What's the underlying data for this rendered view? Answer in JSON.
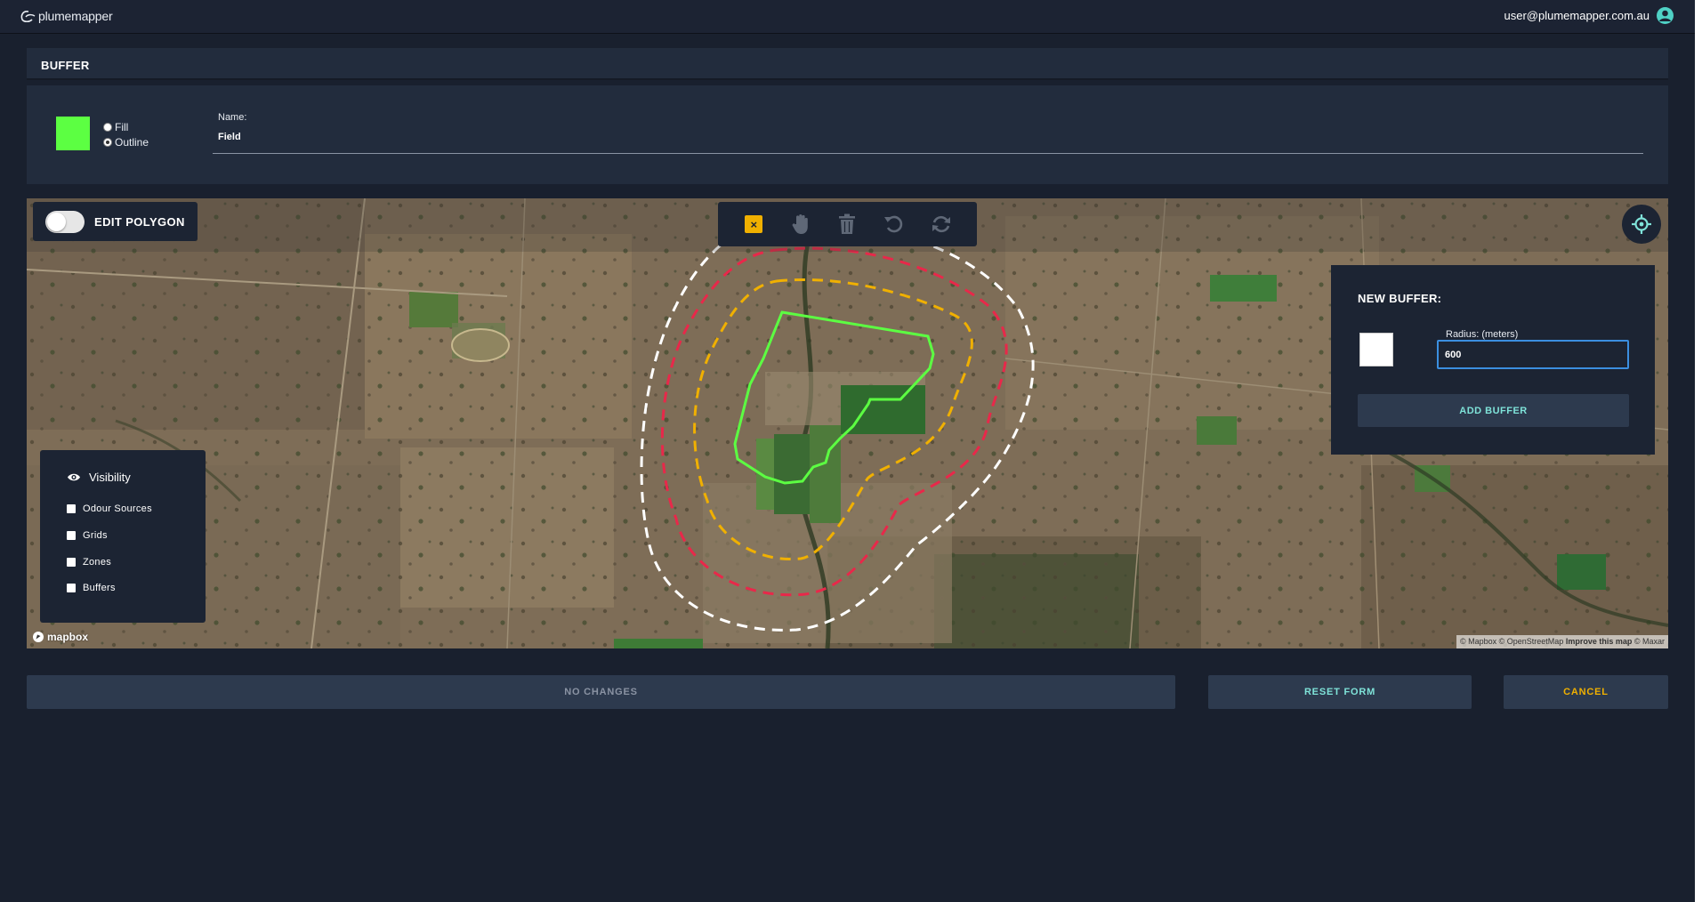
{
  "topbar": {
    "logo_text": "plumemapper",
    "user_email": "user@plumemapper.com.au"
  },
  "panel": {
    "title": "BUFFER",
    "swatch_color": "#5cff42",
    "fill_label": "Fill",
    "outline_label": "Outline",
    "selected_style": "Outline",
    "name_label": "Name:",
    "name_value": "Field"
  },
  "map": {
    "edit_polygon_label": "EDIT POLYGON",
    "edit_polygon_on": false,
    "toolbar_icons": [
      "close-icon",
      "hand-icon",
      "trash-icon",
      "undo-icon",
      "redo-icon"
    ],
    "polygon_color": "#5cff42",
    "buffer_colors": [
      "#f0b000",
      "#e8284a",
      "#ffffff"
    ],
    "new_buffer": {
      "title": "NEW BUFFER:",
      "swatch_color": "#ffffff",
      "radius_label": "Radius: (meters)",
      "radius_value": "600",
      "add_label": "ADD BUFFER"
    },
    "visibility": {
      "title": "Visibility",
      "items": [
        {
          "label": "Odour Sources",
          "checked": false
        },
        {
          "label": "Grids",
          "checked": false
        },
        {
          "label": "Zones",
          "checked": false
        },
        {
          "label": "Buffers",
          "checked": false
        }
      ]
    },
    "mapbox_label": "mapbox",
    "attribution": {
      "mapbox": "© Mapbox",
      "osm": "© OpenStreetMap",
      "improve": "Improve this map",
      "maxar": "© Maxar"
    }
  },
  "actions": {
    "no_changes": "NO CHANGES",
    "reset": "RESET FORM",
    "cancel": "CANCEL"
  }
}
